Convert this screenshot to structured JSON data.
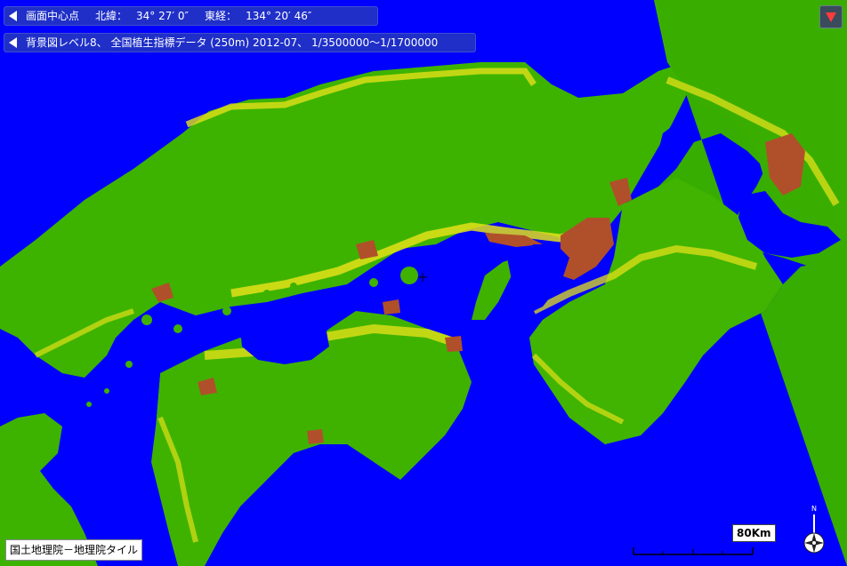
{
  "header": {
    "center_label": "画面中心点",
    "lat_label": "北緯：",
    "lat_value": "34° 27′ 0″",
    "lon_label": "東経：",
    "lon_value": "134° 20′ 46″"
  },
  "layer": {
    "text": "背景図レベル8、 全国植生指標データ (250m) 2012-07、 1/3500000～1/1700000"
  },
  "attribution": "国土地理院－地理院タイル",
  "scale": {
    "label": "80Km"
  },
  "compass": {
    "north_letter": "N"
  },
  "colors": {
    "sea": "#0000ff",
    "vegetation": "#34b000",
    "low_vegetation": "#e3e018",
    "urban": "#b0502a"
  }
}
